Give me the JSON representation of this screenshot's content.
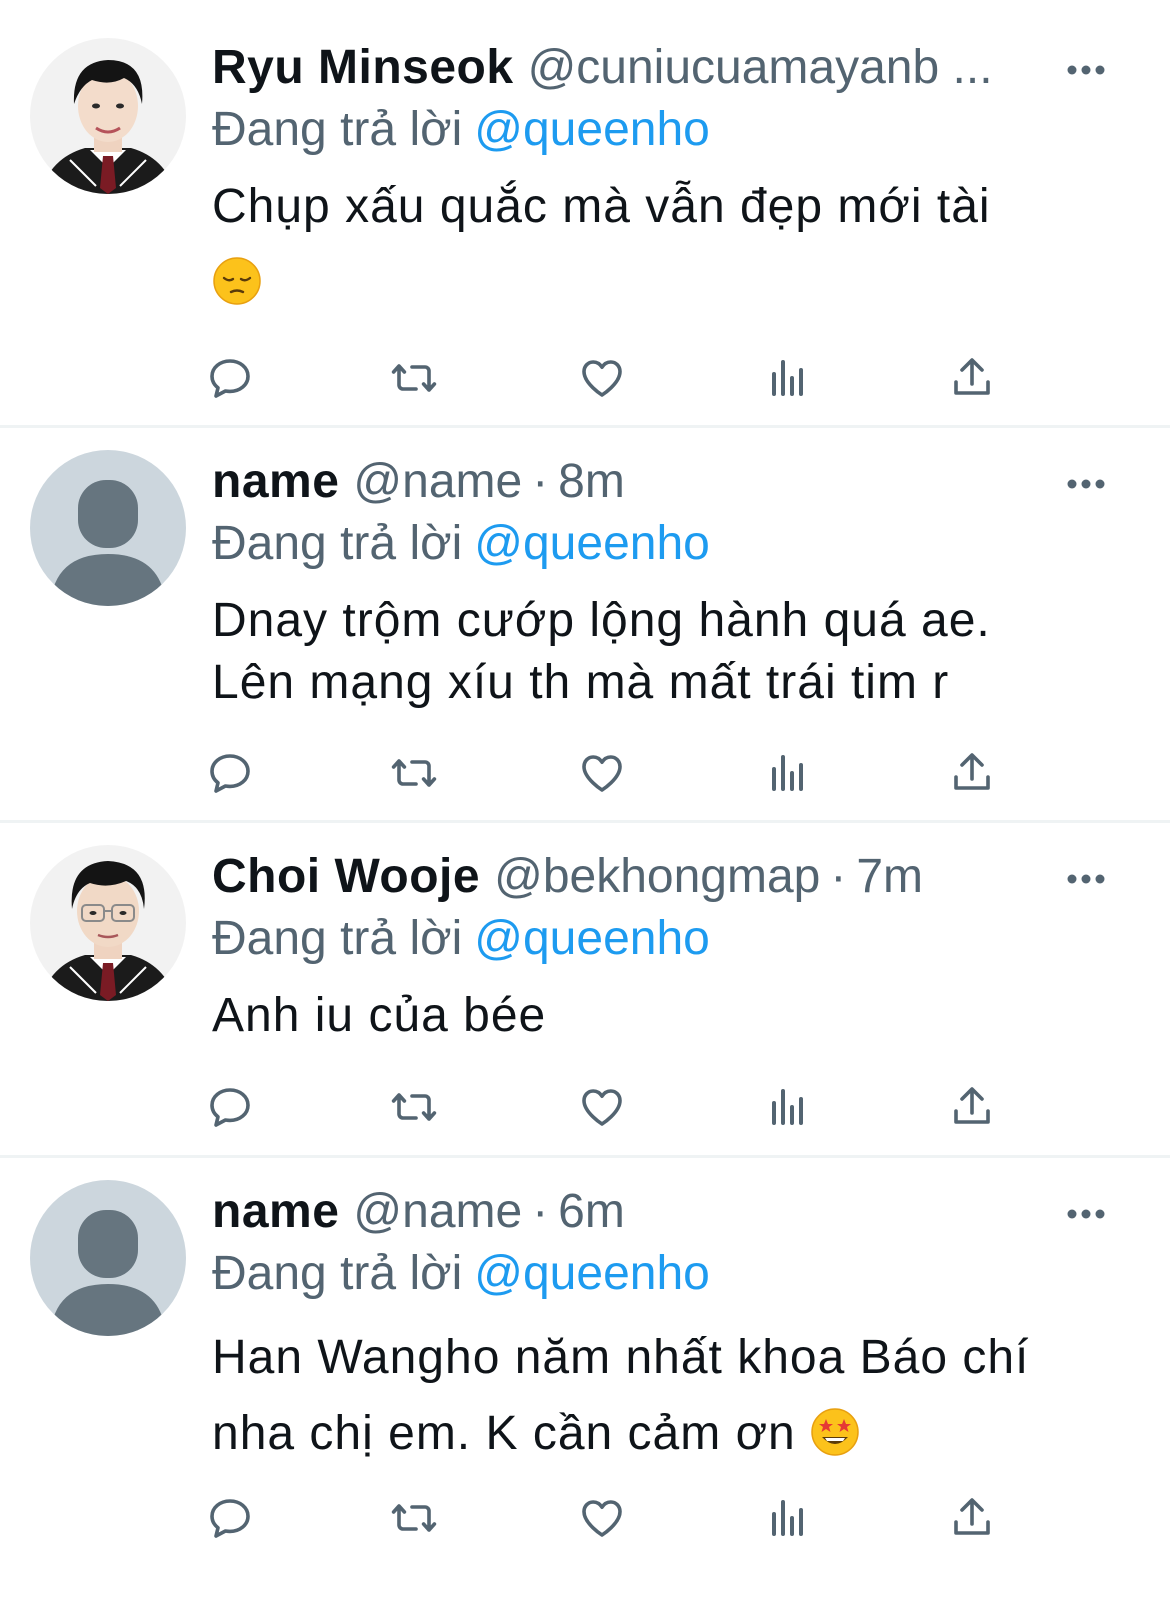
{
  "colors": {
    "text": "#0f1419",
    "secondary": "#536471",
    "mention": "#1d9bf0",
    "divider": "#eff3f4",
    "default_avatar_bg": "#ccd6dd",
    "default_avatar_fg": "#66757f"
  },
  "tweets": [
    {
      "display_name": "Ryu Minseok",
      "handle": "@cuniucuamayanb ...",
      "separator": "",
      "time": "",
      "reply_prefix": "Đang trả lời",
      "reply_to": "@queenho",
      "text_lines": [
        "Chụp xấu quắc mà vẫn đẹp mới tài",
        ""
      ],
      "emoji": "pensive-face-emoji",
      "avatar": "person-photo-avatar",
      "actions": [
        "reply-icon",
        "retweet-icon",
        "like-icon",
        "views-icon",
        "share-icon"
      ]
    },
    {
      "display_name": "name",
      "handle": "@name",
      "separator": "·",
      "time": "8m",
      "reply_prefix": "Đang trả lời",
      "reply_to": "@queenho",
      "text_lines": [
        "Dnay trộm cướp lộng hành quá ae.",
        "Lên mạng xíu th mà mất trái tim r"
      ],
      "avatar": "default-avatar",
      "actions": [
        "reply-icon",
        "retweet-icon",
        "like-icon",
        "views-icon",
        "share-icon"
      ]
    },
    {
      "display_name": "Choi Wooje",
      "handle": "@bekhongmap",
      "separator": "·",
      "time": "7m",
      "reply_prefix": "Đang trả lời",
      "reply_to": "@queenho",
      "text_lines": [
        "Anh iu của bée"
      ],
      "avatar": "person-photo-avatar-glasses",
      "actions": [
        "reply-icon",
        "retweet-icon",
        "like-icon",
        "views-icon",
        "share-icon"
      ]
    },
    {
      "display_name": "name",
      "handle": "@name",
      "separator": "·",
      "time": "6m",
      "reply_prefix": "Đang trả lời",
      "reply_to": "@queenho",
      "text_lines": [
        "Han Wangho năm nhất khoa Báo chí",
        "nha chị em. K cần cảm ơn"
      ],
      "emoji": "star-struck-emoji",
      "avatar": "default-avatar",
      "actions": [
        "reply-icon",
        "retweet-icon",
        "like-icon",
        "views-icon",
        "share-icon"
      ]
    }
  ]
}
